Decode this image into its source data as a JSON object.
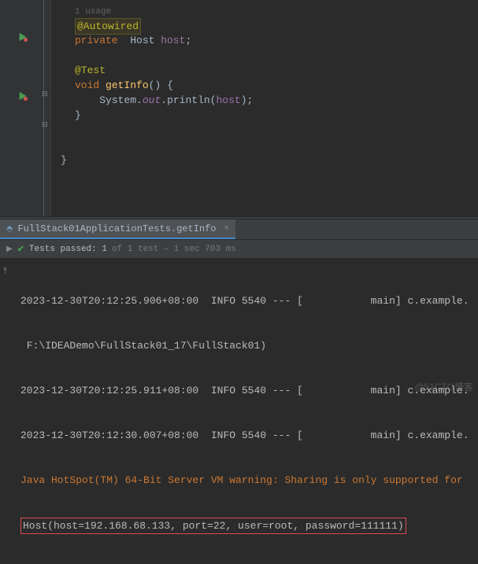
{
  "editor": {
    "usage_hint": "1 usage",
    "annotation_autowired": "@Autowired",
    "kw_private": "private",
    "type_host": "Host",
    "field_host": "host",
    "annotation_test": "@Test",
    "kw_void": "void",
    "method_getinfo": "getInfo",
    "sys": "System",
    "out": "out",
    "println": "println",
    "arg_host": "host",
    "semi": ";",
    "lparen": "(",
    "rparen": ")",
    "lbrace": "{",
    "rbrace": "}",
    "dot": "."
  },
  "run_tab": {
    "label": "FullStack01ApplicationTests.getInfo",
    "close": "×"
  },
  "test_status": {
    "passed_prefix": "Tests passed: 1",
    "of": " of 1 test",
    "timing": " – 1 sec 703 ms"
  },
  "console": {
    "line1": "2023-12-30T20:12:25.906+08:00  INFO 5540 --- [           main] c.example.",
    "line2": " F:\\IDEADemo\\FullStack01_17\\FullStack01)",
    "line3": "2023-12-30T20:12:25.911+08:00  INFO 5540 --- [           main] c.example.",
    "line4": "2023-12-30T20:12:30.007+08:00  INFO 5540 --- [           main] c.example.",
    "warn": "Java HotSpot(TM) 64-Bit Server VM warning: Sharing is only supported for ",
    "result": "Host(host=192.168.68.133, port=22, user=root, password=111111)"
  },
  "watermark": "@51CTO博客"
}
